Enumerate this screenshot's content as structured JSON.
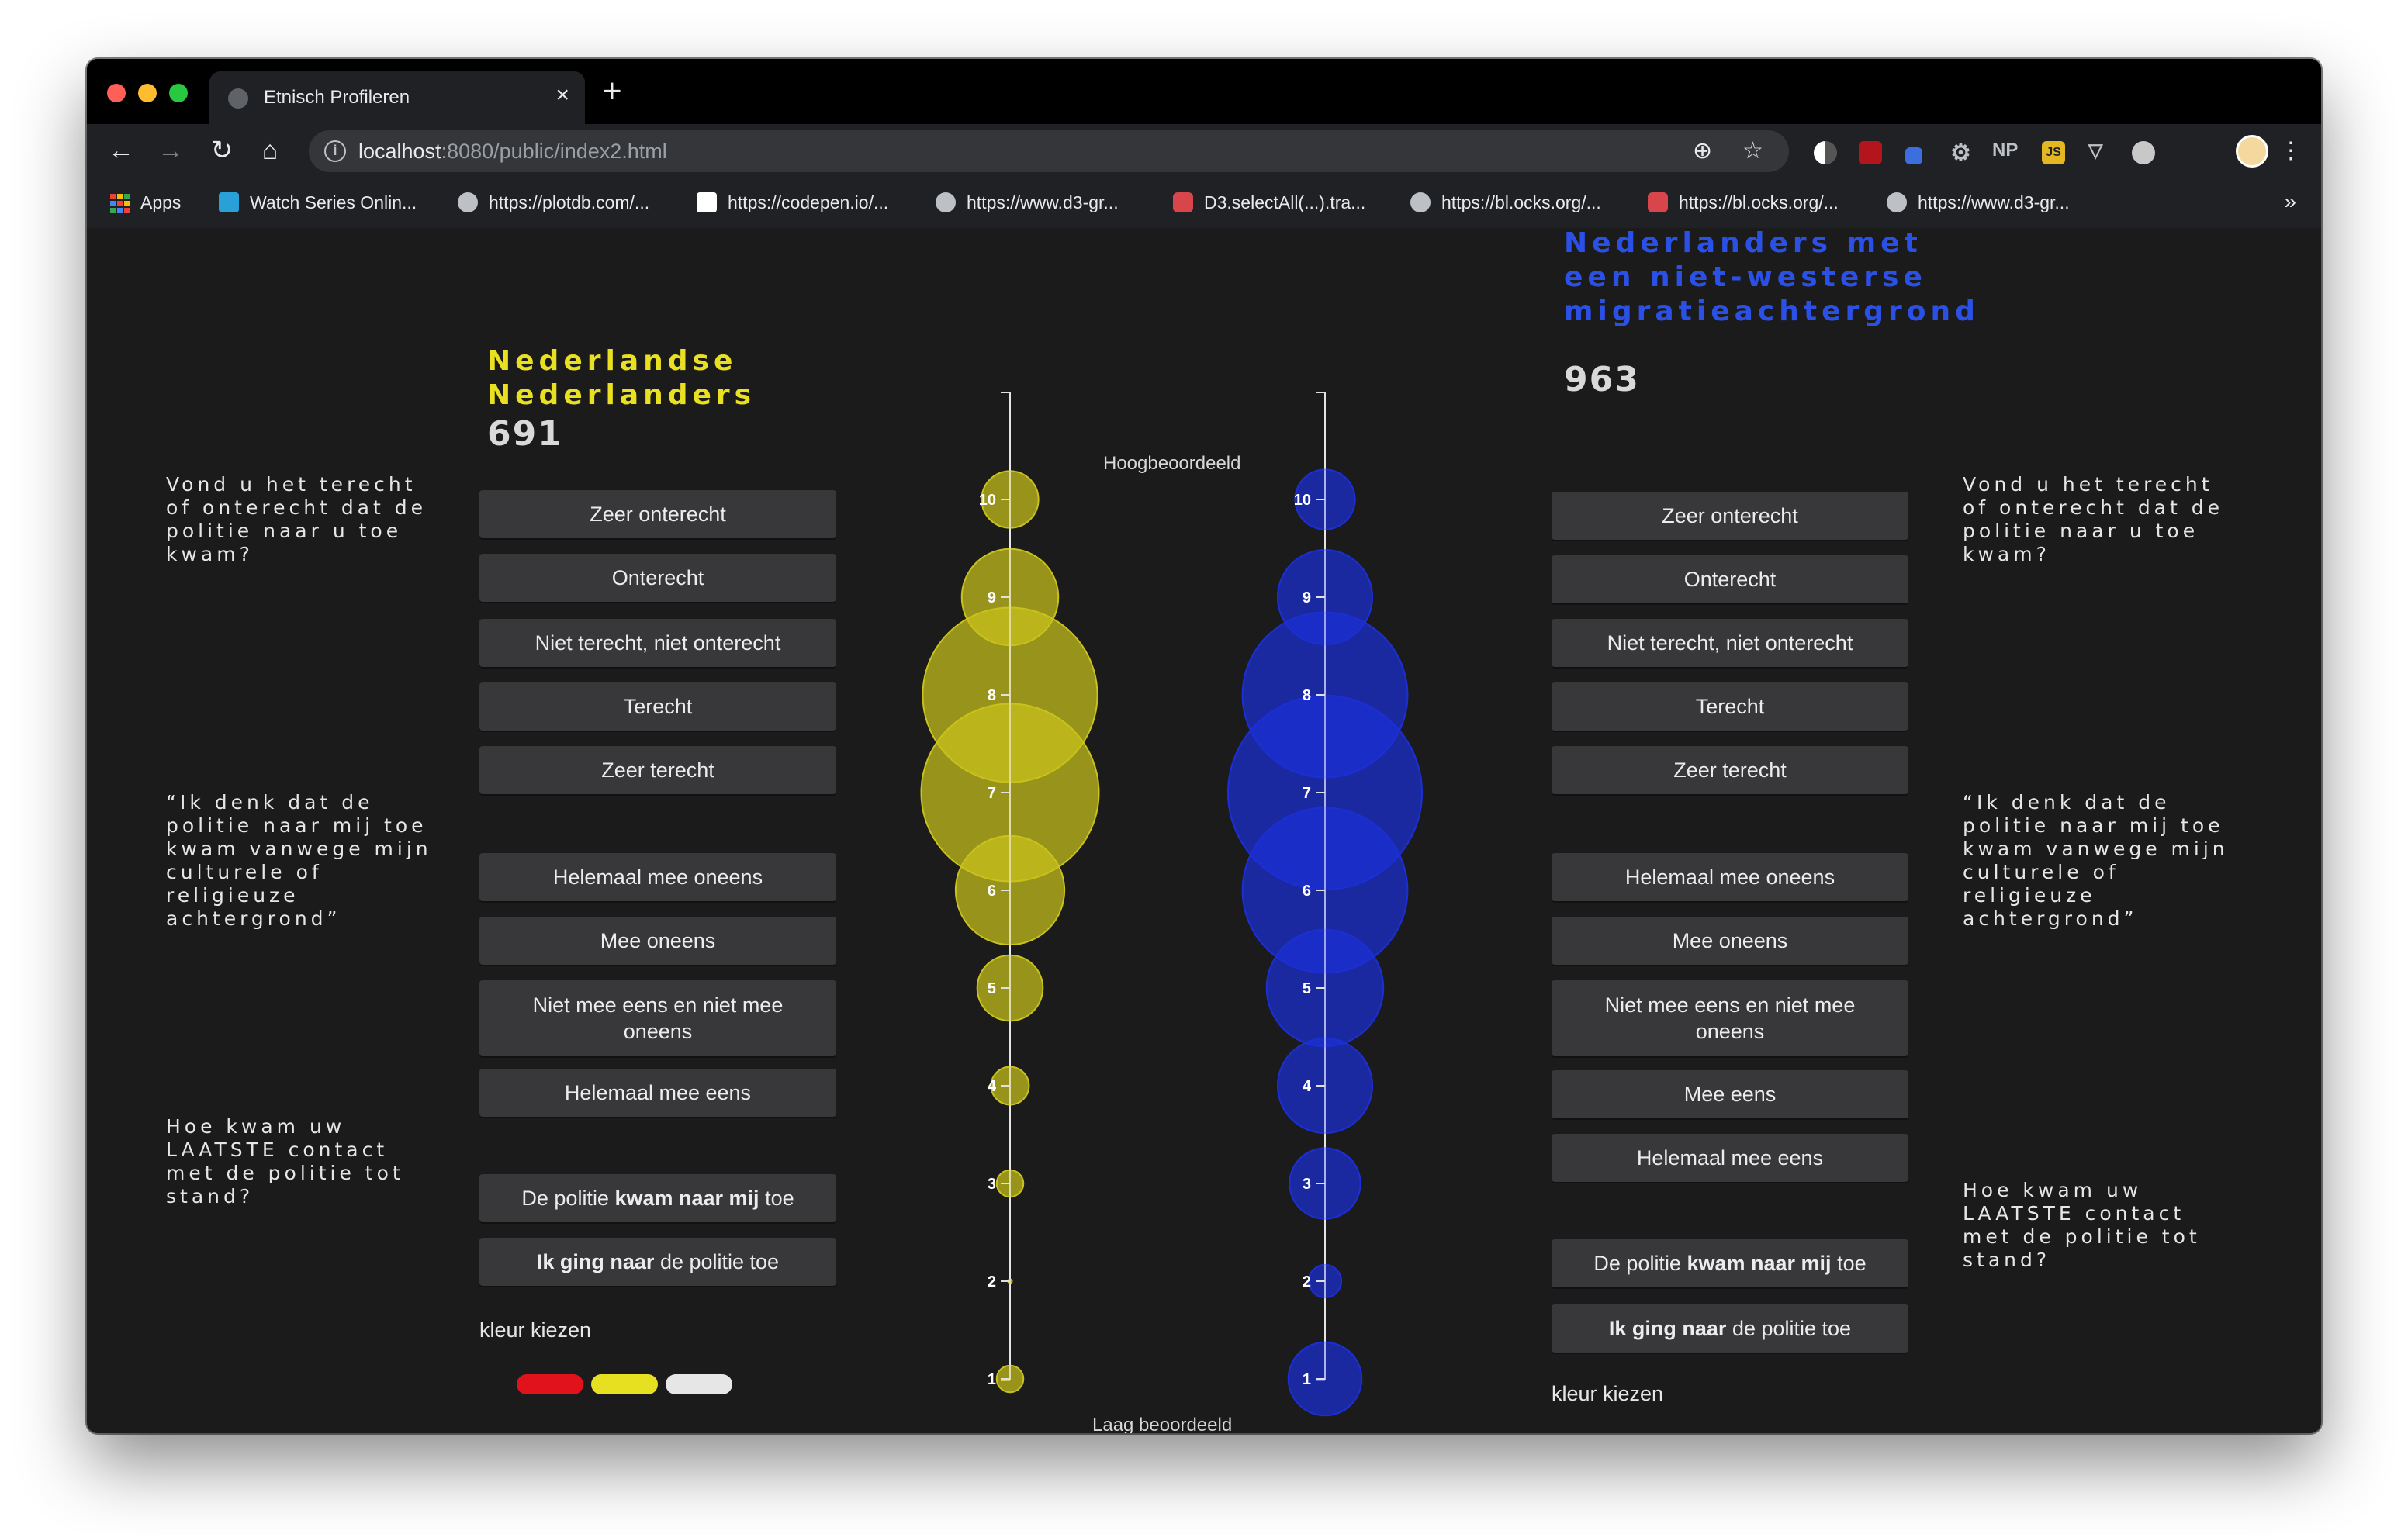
{
  "browser": {
    "tab_title": "Etnisch Profileren",
    "tab_close": "×",
    "new_tab": "+",
    "url_host": "localhost",
    "url_rest": ":8080/public/index2.html",
    "ext_np": "NP",
    "ext_js": "JS",
    "bookmarks": [
      {
        "label": "Apps",
        "icon": "apps-grid-icon"
      },
      {
        "label": "Watch Series Onlin...",
        "icon": "site-icon"
      },
      {
        "label": "https://plotdb.com/...",
        "icon": "globe-icon"
      },
      {
        "label": "https://codepen.io/...",
        "icon": "codepen-icon"
      },
      {
        "label": "https://www.d3-gr...",
        "icon": "globe-icon"
      },
      {
        "label": "D3.selectAll(...).tra...",
        "icon": "site-icon"
      },
      {
        "label": "https://bl.ocks.org/...",
        "icon": "globe-icon"
      },
      {
        "label": "https://bl.ocks.org/...",
        "icon": "site-icon"
      },
      {
        "label": "https://www.d3-gr...",
        "icon": "globe-icon"
      }
    ],
    "bookmarks_more": "»"
  },
  "left": {
    "title": "Nederlandse Nederlanders",
    "title_color": "#e8e020",
    "count": "691",
    "q1": "Vond u het terecht of onterecht dat de politie naar u toe kwam?",
    "q1_options": [
      "Zeer onterecht",
      "Onterecht",
      "Niet terecht, niet onterecht",
      "Terecht",
      "Zeer terecht"
    ],
    "q2": "“Ik denk dat de politie naar mij toe kwam vanwege mijn culturele of religieuze achtergrond”",
    "q2_options": [
      "Helemaal mee oneens",
      "Mee oneens",
      "Niet mee eens en niet mee oneens",
      "Helemaal mee eens"
    ],
    "q3": "Hoe kwam uw LAATSTE contact met de politie tot stand?",
    "q3_opt1": {
      "pre": "De politie ",
      "bold": "kwam naar mij",
      "post": " toe"
    },
    "q3_opt2": {
      "pre": "",
      "bold": "Ik ging naar",
      "post": " de politie toe"
    },
    "kleur_label": "kleur kiezen",
    "swatches": [
      "#e2121c",
      "#e6e021",
      "#e6e6e6"
    ]
  },
  "right": {
    "title": "Nederlanders met een niet-westerse migratieachtergrond",
    "title_color": "#2b50e6",
    "count": "963",
    "q1": "Vond u het terecht of onterecht dat de politie naar u toe kwam?",
    "q1_options": [
      "Zeer onterecht",
      "Onterecht",
      "Niet terecht, niet onterecht",
      "Terecht",
      "Zeer terecht"
    ],
    "q2": "“Ik denk dat de politie naar mij toe kwam vanwege mijn culturele of religieuze achtergrond”",
    "q2_options": [
      "Helemaal mee oneens",
      "Mee oneens",
      "Niet mee eens en niet mee oneens",
      "Mee eens",
      "Helemaal mee eens"
    ],
    "q3": "Hoe kwam uw LAATSTE contact met de politie tot stand?",
    "q3_opt1": {
      "pre": "De politie ",
      "bold": "kwam naar mij",
      "post": " toe"
    },
    "q3_opt2": {
      "pre": "",
      "bold": "Ik ging naar",
      "post": " de politie toe"
    },
    "kleur_label": "kleur kiezen",
    "swatches": [
      "#e2121c",
      "#1430e6",
      "#e6e6e6"
    ]
  },
  "axis": {
    "top_label": "Hoogbeoordeeld",
    "bottom_label": "Laag beoordeeld"
  },
  "chart_data": {
    "type": "scatter",
    "encoding": "bubble size = relative share of respondents per rating",
    "y_ticks": [
      "1",
      "2",
      "3",
      "4",
      "5",
      "6",
      "7",
      "8",
      "9",
      "10"
    ],
    "ylim": [
      1,
      10
    ],
    "series": [
      {
        "name": "Nederlandse Nederlanders",
        "color": "#c9c21c",
        "points": [
          {
            "rating": 1,
            "size": 0.2
          },
          {
            "rating": 2,
            "size": 0.0
          },
          {
            "rating": 3,
            "size": 0.2
          },
          {
            "rating": 4,
            "size": 0.4
          },
          {
            "rating": 5,
            "size": 1.2
          },
          {
            "rating": 6,
            "size": 3.3
          },
          {
            "rating": 7,
            "size": 8.8
          },
          {
            "rating": 8,
            "size": 8.5
          },
          {
            "rating": 9,
            "size": 2.6
          },
          {
            "rating": 10,
            "size": 0.9
          }
        ]
      },
      {
        "name": "Nederlanders met een niet-westerse migratieachtergrond",
        "color": "#1c2fd6",
        "points": [
          {
            "rating": 1,
            "size": 1.5
          },
          {
            "rating": 2,
            "size": 0.3
          },
          {
            "rating": 3,
            "size": 1.4
          },
          {
            "rating": 4,
            "size": 2.5
          },
          {
            "rating": 5,
            "size": 3.8
          },
          {
            "rating": 6,
            "size": 7.6
          },
          {
            "rating": 7,
            "size": 10.5
          },
          {
            "rating": 8,
            "size": 7.6
          },
          {
            "rating": 9,
            "size": 2.5
          },
          {
            "rating": 10,
            "size": 1.0
          }
        ]
      }
    ]
  }
}
